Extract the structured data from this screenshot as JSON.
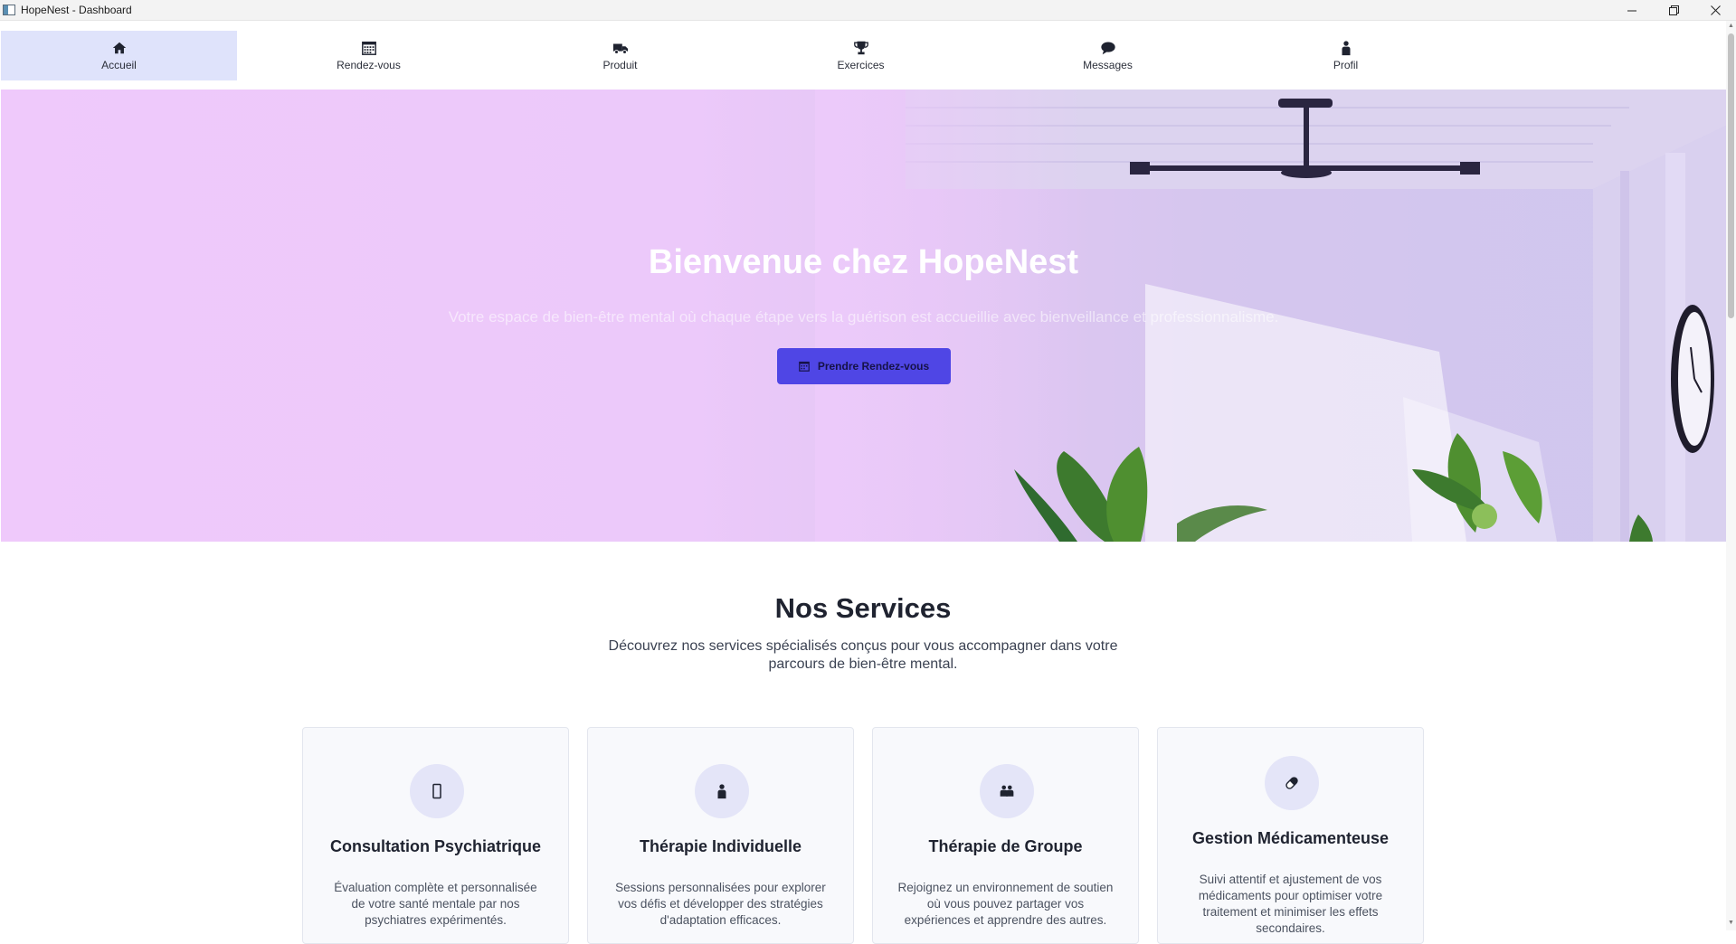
{
  "window": {
    "title": "HopeNest - Dashboard",
    "controls": {
      "minimize": "—",
      "restore": "❐",
      "close": "✕"
    }
  },
  "nav": {
    "items": [
      {
        "label": "Accueil",
        "icon": "home-icon",
        "active": true
      },
      {
        "label": "Rendez-vous",
        "icon": "calendar-icon",
        "active": false
      },
      {
        "label": "Produit",
        "icon": "truck-icon",
        "active": false
      },
      {
        "label": "Exercices",
        "icon": "trophy-icon",
        "active": false
      },
      {
        "label": "Messages",
        "icon": "chat-icon",
        "active": false
      },
      {
        "label": "Profil",
        "icon": "user-icon",
        "active": false
      }
    ]
  },
  "hero": {
    "title": "Bienvenue chez HopeNest",
    "subtitle": "Votre espace de bien-être mental où chaque étape vers la guérison est accueillie avec bienveillance et professionnalisme.",
    "button_label": "Prendre Rendez-vous"
  },
  "services": {
    "title": "Nos Services",
    "subtitle": "Découvrez nos services spécialisés conçus pour vous accompagner dans votre parcours de bien-être mental.",
    "cards": [
      {
        "icon": "phone-icon",
        "title": "Consultation Psychiatrique",
        "text": "Évaluation complète et personnalisée de votre santé mentale par nos psychiatres expérimentés."
      },
      {
        "icon": "user-icon",
        "title": "Thérapie Individuelle",
        "text": "Sessions personnalisées pour explorer vos défis et développer des stratégies d'adaptation efficaces."
      },
      {
        "icon": "group-icon",
        "title": "Thérapie de Groupe",
        "text": "Rejoignez un environnement de soutien où vous pouvez partager vos expériences et apprendre des autres."
      },
      {
        "icon": "pill-icon",
        "title": "Gestion Médicamenteuse",
        "text": "Suivi attentif et ajustement de vos médicaments pour optimiser votre traitement et minimiser les effets secondaires."
      }
    ]
  },
  "colors": {
    "accent": "#4f46e5",
    "nav_active": "#dfe3fb",
    "hero_bg": "#efc9fb",
    "card_bg": "#f8f9fc",
    "icon_circle": "#e4e5f8"
  }
}
